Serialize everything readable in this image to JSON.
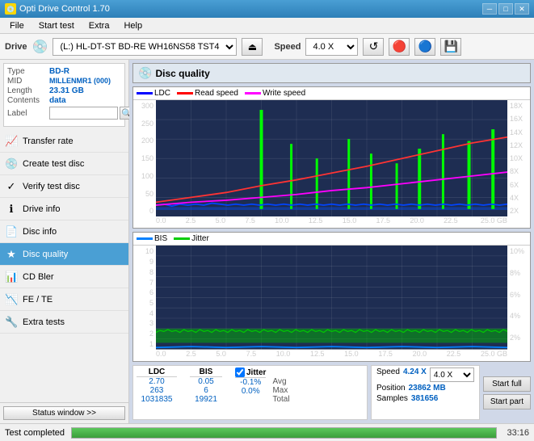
{
  "app": {
    "title": "Opti Drive Control 1.70",
    "icon": "💿"
  },
  "titlebar": {
    "minimize": "─",
    "maximize": "□",
    "close": "✕"
  },
  "menubar": {
    "items": [
      "File",
      "Start test",
      "Extra",
      "Help"
    ]
  },
  "toolbar": {
    "drive_label": "Drive",
    "drive_value": "(L:)  HL-DT-ST BD-RE  WH16NS58 TST4",
    "speed_label": "Speed",
    "speed_value": "4.0 X"
  },
  "disc": {
    "type_label": "Type",
    "type_value": "BD-R",
    "mid_label": "MID",
    "mid_value": "MILLENMR1 (000)",
    "length_label": "Length",
    "length_value": "23.31 GB",
    "contents_label": "Contents",
    "contents_value": "data",
    "label_label": "Label",
    "label_placeholder": ""
  },
  "nav": {
    "items": [
      {
        "id": "transfer-rate",
        "label": "Transfer rate",
        "icon": "📈"
      },
      {
        "id": "create-test-disc",
        "label": "Create test disc",
        "icon": "💿"
      },
      {
        "id": "verify-test-disc",
        "label": "Verify test disc",
        "icon": "✓"
      },
      {
        "id": "drive-info",
        "label": "Drive info",
        "icon": "ℹ"
      },
      {
        "id": "disc-info",
        "label": "Disc info",
        "icon": "📄"
      },
      {
        "id": "disc-quality",
        "label": "Disc quality",
        "icon": "★",
        "active": true
      },
      {
        "id": "cd-bler",
        "label": "CD Bler",
        "icon": "📊"
      },
      {
        "id": "fe-te",
        "label": "FE / TE",
        "icon": "📉"
      },
      {
        "id": "extra-tests",
        "label": "Extra tests",
        "icon": "🔧"
      }
    ]
  },
  "quality_panel": {
    "title": "Disc quality",
    "icon": "💿"
  },
  "chart1": {
    "title": "LDC chart",
    "legend": {
      "ldc": "LDC",
      "read_speed": "Read speed",
      "write_speed": "Write speed"
    },
    "y_axis_left": [
      "300",
      "250",
      "200",
      "150",
      "100",
      "50",
      "0"
    ],
    "y_axis_right": [
      "18X",
      "16X",
      "14X",
      "12X",
      "10X",
      "8X",
      "6X",
      "4X",
      "2X"
    ],
    "x_axis": [
      "0.0",
      "2.5",
      "5.0",
      "7.5",
      "10.0",
      "12.5",
      "15.0",
      "17.5",
      "20.0",
      "22.5",
      "25.0 GB"
    ]
  },
  "chart2": {
    "title": "BIS/Jitter chart",
    "legend": {
      "bis": "BIS",
      "jitter": "Jitter"
    },
    "y_axis_left": [
      "10",
      "9",
      "8",
      "7",
      "6",
      "5",
      "4",
      "3",
      "2",
      "1"
    ],
    "y_axis_right": [
      "10%",
      "8%",
      "6%",
      "4%",
      "2%"
    ],
    "x_axis": [
      "0.0",
      "2.5",
      "5.0",
      "7.5",
      "10.0",
      "12.5",
      "15.0",
      "17.5",
      "20.0",
      "22.5",
      "25.0 GB"
    ]
  },
  "stats": {
    "ldc_label": "LDC",
    "bis_label": "BIS",
    "jitter_label": "Jitter",
    "speed_label": "Speed",
    "avg_label": "Avg",
    "avg_ldc": "2.70",
    "avg_bis": "0.05",
    "avg_jitter": "-0.1%",
    "max_label": "Max",
    "max_ldc": "263",
    "max_bis": "6",
    "max_jitter": "0.0%",
    "total_label": "Total",
    "total_ldc": "1031835",
    "total_bis": "19921",
    "speed_val": "4.24 X",
    "position_label": "Position",
    "position_val": "23862 MB",
    "samples_label": "Samples",
    "samples_val": "381656",
    "start_full": "Start full",
    "start_part": "Start part",
    "speed_dropdown": "4.0 X"
  },
  "statusbar": {
    "status_btn": "Status window >>",
    "status_text": "Test completed",
    "progress": 100,
    "time": "33:16"
  }
}
